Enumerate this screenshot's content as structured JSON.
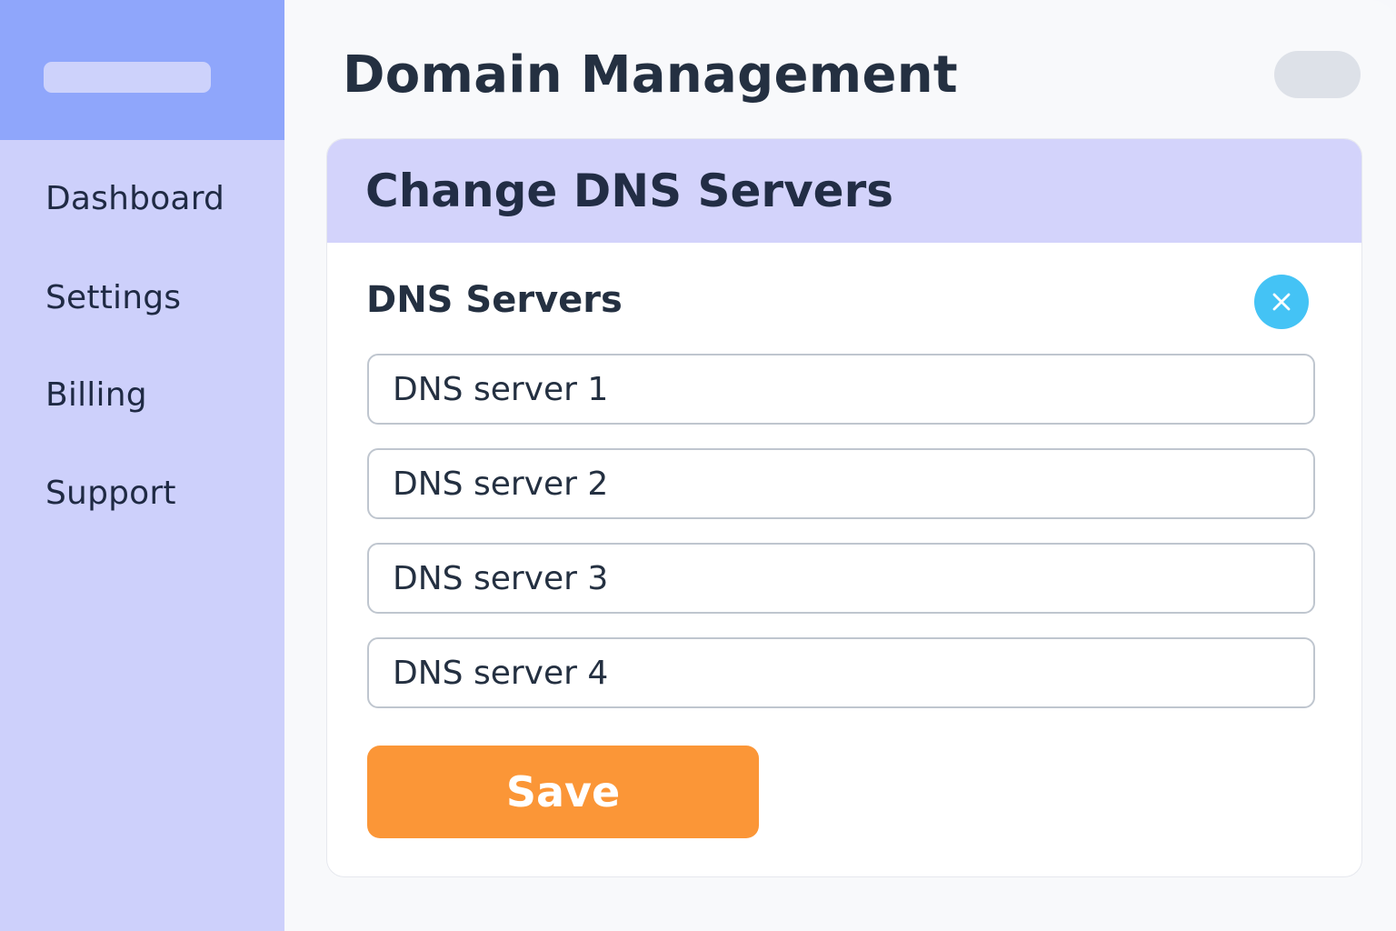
{
  "sidebar": {
    "items": [
      {
        "label": "Dashboard"
      },
      {
        "label": "Settings"
      },
      {
        "label": "Billing"
      },
      {
        "label": "Support"
      }
    ]
  },
  "header": {
    "title": "Domain Management"
  },
  "card": {
    "title": "Change DNS Servers",
    "section_title": "DNS Servers",
    "close_icon": "close-icon",
    "fields": [
      {
        "value": "",
        "placeholder": "DNS server 1"
      },
      {
        "value": "",
        "placeholder": "DNS server 2"
      },
      {
        "value": "",
        "placeholder": "DNS server 3"
      },
      {
        "value": "",
        "placeholder": "DNS server 4"
      }
    ],
    "save_label": "Save"
  },
  "colors": {
    "sidebar_top": "#8fa6fb",
    "sidebar": "#cdd0fb",
    "card_header": "#d3d3fb",
    "close_button": "#44c3f5",
    "save_button": "#fb9637"
  }
}
